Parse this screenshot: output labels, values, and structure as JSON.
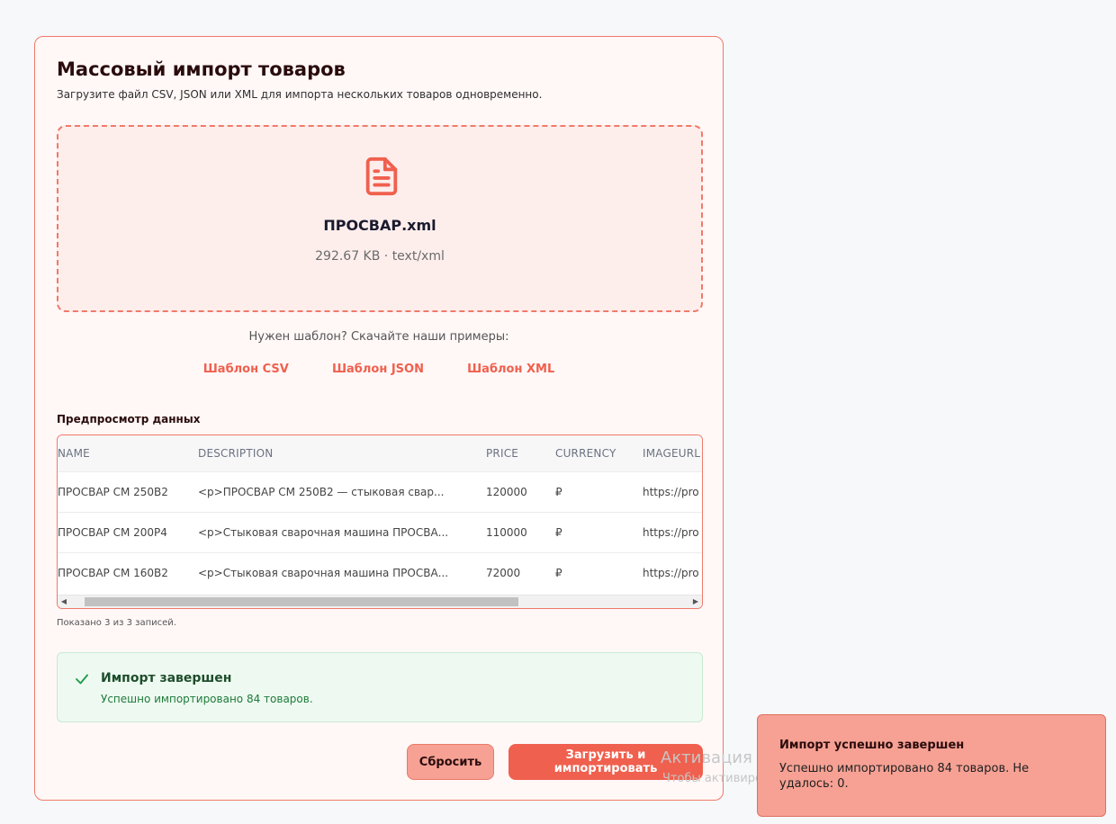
{
  "page": {
    "title": "Массовый импорт товаров",
    "subtitle": "Загрузите файл CSV, JSON или XML для импорта нескольких товаров одновременно."
  },
  "dropzone": {
    "icon": "file-text-icon",
    "file_name": "ПРОСВАР.xml",
    "file_meta": "292.67 KB · text/xml"
  },
  "templates": {
    "hint": "Нужен шаблон? Скачайте наши примеры:",
    "links": [
      "Шаблон CSV",
      "Шаблон JSON",
      "Шаблон XML"
    ]
  },
  "preview": {
    "title": "Предпросмотр данных",
    "columns": [
      "NAME",
      "DESCRIPTION",
      "PRICE",
      "CURRENCY",
      "IMAGEURL"
    ],
    "rows": [
      [
        "ПРОСВАР СМ 250В2",
        "<p>ПРОСВАР СМ 250В2 — стыковая свар...",
        "120000",
        "₽",
        "https://pro"
      ],
      [
        "ПРОСВАР СМ 200Р4",
        "<p>Стыковая сварочная машина ПРОСВА...",
        "110000",
        "₽",
        "https://pro"
      ],
      [
        "ПРОСВАР СМ 160В2",
        "<p>Стыковая сварочная машина ПРОСВА...",
        "72000",
        "₽",
        "https://pro"
      ]
    ],
    "count_text": "Показано 3 из 3 записей."
  },
  "success": {
    "icon": "check-icon",
    "title": "Импорт завершен",
    "text": "Успешно импортировано 84 товаров."
  },
  "buttons": {
    "reset": "Сбросить",
    "upload": "Загрузить и импортировать"
  },
  "watermark": {
    "line1": "Активация Windows",
    "line2": "Чтобы активировать Windows, перейдите в раздел \"Параметры\"."
  },
  "toast": {
    "title": "Импорт успешно завершен",
    "text": "Успешно импортировано 84 товаров. Не удалось: 0."
  },
  "colors": {
    "accent": "#f0604e",
    "accent_light": "#f6a194",
    "success_bg": "#eefaf1",
    "success_text": "#1f7a3b"
  }
}
